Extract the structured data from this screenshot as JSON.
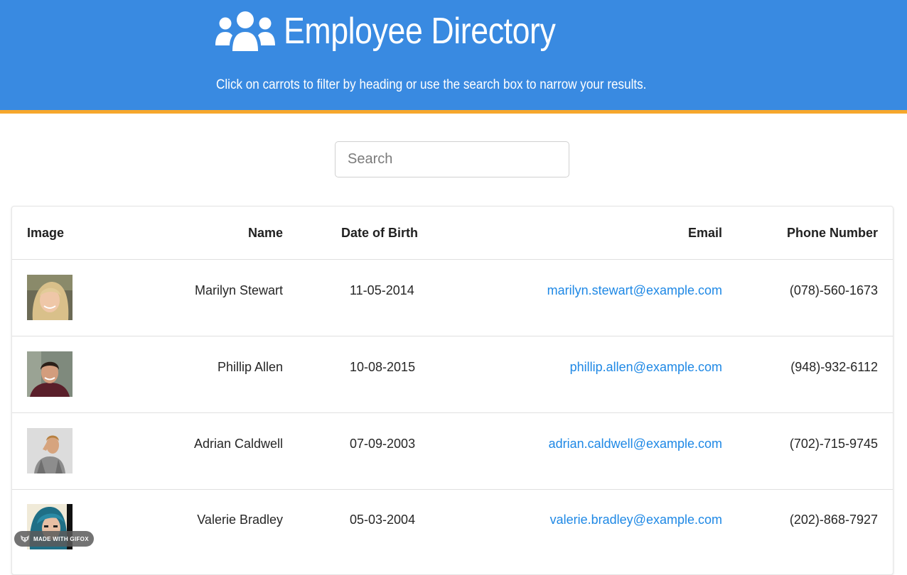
{
  "header": {
    "title": "Employee Directory",
    "subtitle": "Click on carrots to filter by heading or use the search box to narrow your results.",
    "icon": "users-icon",
    "background_color": "#398ae1",
    "accent_color": "#f6a72c"
  },
  "search": {
    "placeholder": "Search",
    "value": ""
  },
  "table": {
    "columns": [
      "Image",
      "Name",
      "Date of Birth",
      "Email",
      "Phone Number"
    ],
    "rows": [
      {
        "image": "photo-woman-blonde",
        "name": "Marilyn Stewart",
        "dob": "11-05-2014",
        "email": "marilyn.stewart@example.com",
        "phone": "(078)-560-1673"
      },
      {
        "image": "photo-man-dark-hair",
        "name": "Phillip Allen",
        "dob": "10-08-2015",
        "email": "phillip.allen@example.com",
        "phone": "(948)-932-6112"
      },
      {
        "image": "photo-man-plaid-shirt",
        "name": "Adrian Caldwell",
        "dob": "07-09-2003",
        "email": "adrian.caldwell@example.com",
        "phone": "(702)-715-9745"
      },
      {
        "image": "photo-woman-blue-hair",
        "name": "Valerie Bradley",
        "dob": "05-03-2004",
        "email": "valerie.bradley@example.com",
        "phone": "(202)-868-7927"
      }
    ]
  },
  "watermark": {
    "label": "MADE WITH GIFOX",
    "icon": "gifox-fox-icon"
  }
}
